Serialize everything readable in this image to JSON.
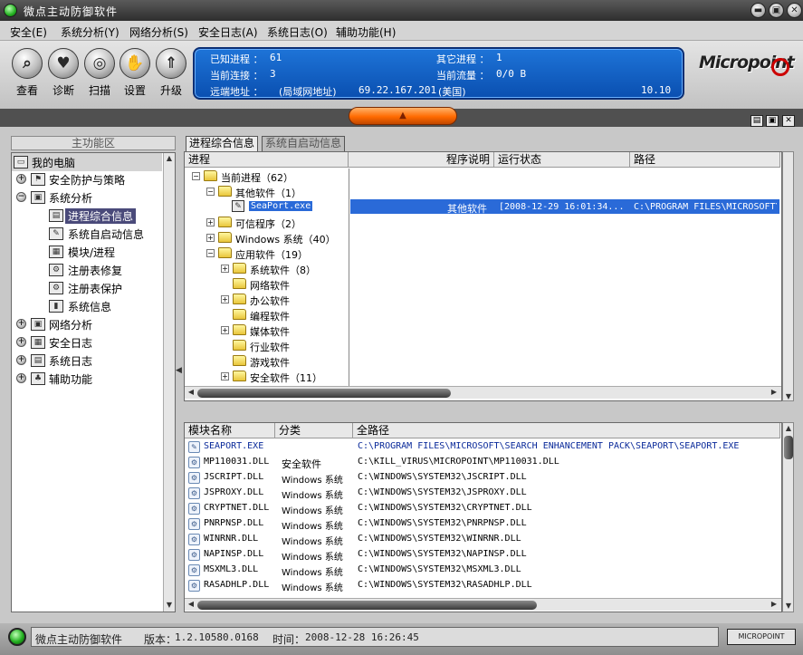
{
  "app": {
    "title": "微点主动防御软件"
  },
  "window_controls": {
    "minimize": "▬",
    "maximize": "▣",
    "close": "✕"
  },
  "menu": [
    "安全(E)",
    "系统分析(Y)",
    "网络分析(S)",
    "安全日志(A)",
    "系统日志(O)",
    "辅助功能(H)"
  ],
  "toolbar": {
    "tools": [
      {
        "label": "查看",
        "icon": "magnifier-icon",
        "glyph": "⌕"
      },
      {
        "label": "诊断",
        "icon": "heart-icon",
        "glyph": "♥"
      },
      {
        "label": "扫描",
        "icon": "scan-icon",
        "glyph": "◎"
      },
      {
        "label": "设置",
        "icon": "settings-icon",
        "glyph": "✋"
      },
      {
        "label": "升级",
        "icon": "upgrade-icon",
        "glyph": "⇑"
      }
    ]
  },
  "info": {
    "known_proc_label": "已知进程 ：",
    "known_proc_value": "61",
    "other_proc_label": "其它进程 ：",
    "other_proc_value": "1",
    "conn_label": "当前连接 ：",
    "conn_value": "3",
    "traffic_label": "当前流量 ：",
    "traffic_value": "0/0 B",
    "remote_label": "远端地址 ：",
    "remote_type": "(局域网地址)",
    "remote_ip": "69.22.167.201",
    "remote_region": "(美国)",
    "remote_extra": "10.10"
  },
  "logo": {
    "text": "Micropoint"
  },
  "collapse_glyph": "▲",
  "left": {
    "header": "主功能区",
    "root": "我的电脑",
    "items": [
      {
        "label": "安全防护与策略",
        "level": 1,
        "expander": "+",
        "icon": "shield-icon",
        "glyph": "⚑"
      },
      {
        "label": "系统分析",
        "level": 1,
        "expander": "−",
        "icon": "monitor-icon",
        "glyph": "▣"
      },
      {
        "label": "进程综合信息",
        "level": 2,
        "icon": "process-icon",
        "glyph": "▤",
        "selected": true
      },
      {
        "label": "系统自启动信息",
        "level": 2,
        "icon": "startup-icon",
        "glyph": "✎"
      },
      {
        "label": "模块/进程",
        "level": 2,
        "icon": "module-icon",
        "glyph": "▦"
      },
      {
        "label": "注册表修复",
        "level": 2,
        "icon": "registry-repair-icon",
        "glyph": "⚙"
      },
      {
        "label": "注册表保护",
        "level": 2,
        "icon": "registry-protect-icon",
        "glyph": "⚙"
      },
      {
        "label": "系统信息",
        "level": 2,
        "icon": "sysinfo-icon",
        "glyph": "▮"
      },
      {
        "label": "网络分析",
        "level": 1,
        "expander": "+",
        "icon": "network-icon",
        "glyph": "▣"
      },
      {
        "label": "安全日志",
        "level": 1,
        "expander": "+",
        "icon": "security-log-icon",
        "glyph": "▦"
      },
      {
        "label": "系统日志",
        "level": 1,
        "expander": "+",
        "icon": "system-log-icon",
        "glyph": "▤"
      },
      {
        "label": "辅助功能",
        "level": 1,
        "expander": "+",
        "icon": "tools-icon",
        "glyph": "♣"
      }
    ]
  },
  "tabs": [
    "进程综合信息",
    "系统自启动信息"
  ],
  "process": {
    "columns": [
      "进程",
      "程序说明",
      "运行状态",
      "路径"
    ],
    "tree": [
      {
        "label": "当前进程（62）",
        "depth": 0,
        "expander": "−"
      },
      {
        "label": "其他软件（1）",
        "depth": 1,
        "expander": "−"
      },
      {
        "label": "SeaPort.exe",
        "depth": 2,
        "selected": true,
        "mono": true
      },
      {
        "label": "可信程序（2）",
        "depth": 1,
        "expander": "+"
      },
      {
        "label": "Windows 系统（40）",
        "depth": 1,
        "expander": "+"
      },
      {
        "label": "应用软件（19）",
        "depth": 1,
        "expander": "−"
      },
      {
        "label": "系统软件（8）",
        "depth": 2,
        "expander": "+"
      },
      {
        "label": "网络软件",
        "depth": 2
      },
      {
        "label": "办公软件",
        "depth": 2,
        "expander": "+"
      },
      {
        "label": "编程软件",
        "depth": 2
      },
      {
        "label": "媒体软件",
        "depth": 2,
        "expander": "+"
      },
      {
        "label": "行业软件",
        "depth": 2
      },
      {
        "label": "游戏软件",
        "depth": 2
      },
      {
        "label": "安全软件（11）",
        "depth": 2,
        "expander": "+"
      }
    ],
    "selected_desc": "其他软件",
    "selected_status": "[2008-12-29 16:01:34...",
    "selected_path": "C:\\PROGRAM FILES\\MICROSOFT\\"
  },
  "modules": {
    "columns": [
      "模块名称",
      "分类",
      "全路径"
    ],
    "rows": [
      {
        "name": "SEAPORT.EXE",
        "category": "",
        "path": "C:\\PROGRAM FILES\\MICROSOFT\\SEARCH ENHANCEMENT PACK\\SEAPORT\\SEAPORT.EXE",
        "highlight": true
      },
      {
        "name": "MP110031.DLL",
        "category": "安全软件",
        "path": "C:\\KILL_VIRUS\\MICROPOINT\\MP110031.DLL"
      },
      {
        "name": "JSCRIPT.DLL",
        "category": "Windows 系统",
        "path": "C:\\WINDOWS\\SYSTEM32\\JSCRIPT.DLL"
      },
      {
        "name": "JSPROXY.DLL",
        "category": "Windows 系统",
        "path": "C:\\WINDOWS\\SYSTEM32\\JSPROXY.DLL"
      },
      {
        "name": "CRYPTNET.DLL",
        "category": "Windows 系统",
        "path": "C:\\WINDOWS\\SYSTEM32\\CRYPTNET.DLL"
      },
      {
        "name": "PNRPNSP.DLL",
        "category": "Windows 系统",
        "path": "C:\\WINDOWS\\SYSTEM32\\PNRPNSP.DLL"
      },
      {
        "name": "WINRNR.DLL",
        "category": "Windows 系统",
        "path": "C:\\WINDOWS\\SYSTEM32\\WINRNR.DLL"
      },
      {
        "name": "NAPINSP.DLL",
        "category": "Windows 系统",
        "path": "C:\\WINDOWS\\SYSTEM32\\NAPINSP.DLL"
      },
      {
        "name": "MSXML3.DLL",
        "category": "Windows 系统",
        "path": "C:\\WINDOWS\\SYSTEM32\\MSXML3.DLL"
      },
      {
        "name": "RASADHLP.DLL",
        "category": "Windows 系统",
        "path": "C:\\WINDOWS\\SYSTEM32\\RASADHLP.DLL"
      }
    ]
  },
  "status": {
    "app": "微点主动防御软件",
    "version_label": "版本：",
    "version": "1.2.10580.0168",
    "time_label": "时间：",
    "time": "2008-12-28 16:26:45",
    "brand": "MICROPOINT"
  }
}
